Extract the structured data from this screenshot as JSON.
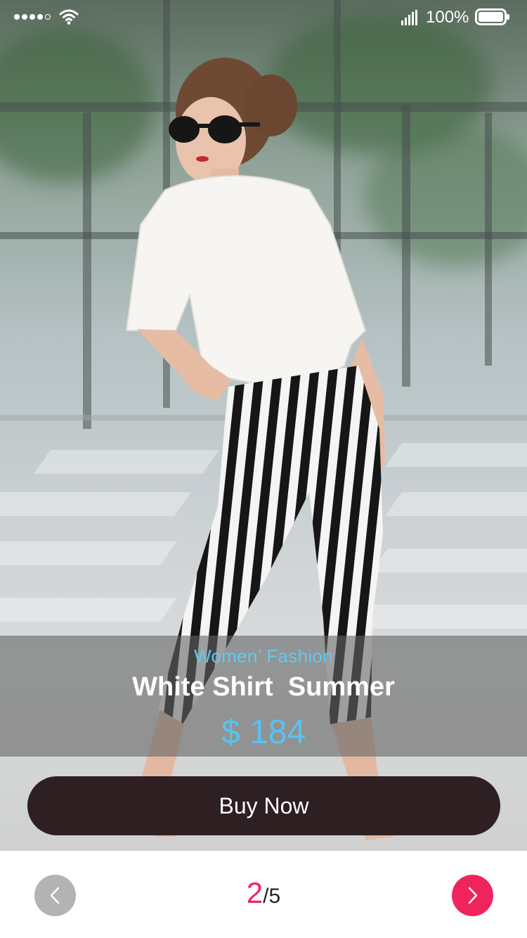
{
  "status_bar": {
    "battery_percent": "100%",
    "signal_dots_filled": 4,
    "signal_dots_total": 5
  },
  "product": {
    "category": "Women’ Fashion",
    "title": "White Shirt  Summer",
    "price": "$ 184"
  },
  "actions": {
    "buy_label": "Buy Now"
  },
  "pager": {
    "current": "2",
    "separator": "/",
    "total": "5"
  },
  "colors": {
    "accent_pink": "#f0245d",
    "price_blue": "#56c4ef",
    "category_blue": "#61c9f2",
    "button_dark": "#2e1f22",
    "prev_gray": "#b3b3b3"
  },
  "icons": {
    "wifi": "wifi-icon",
    "cellular": "cellular-signal-icon",
    "battery": "battery-icon",
    "prev": "chevron-left-icon",
    "next": "chevron-right-icon"
  }
}
